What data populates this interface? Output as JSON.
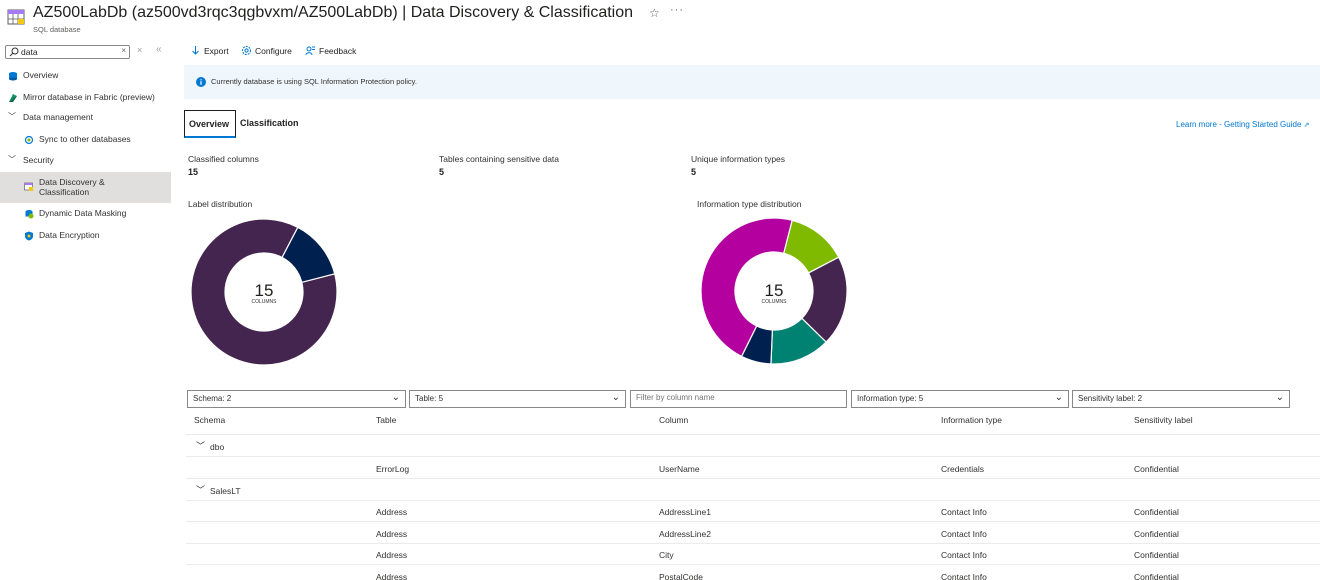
{
  "header": {
    "title": "AZ500LabDb (az500vd3rqc3qgbvxm/AZ500LabDb) | Data Discovery & Classification",
    "subtitle": "SQL database",
    "star": "☆",
    "more": "···"
  },
  "sidebar": {
    "search_value": "data",
    "clear": "×",
    "close": "×",
    "collapse": "«",
    "items": [
      {
        "label": "Overview"
      },
      {
        "label": "Mirror database in Fabric (preview)"
      },
      {
        "label": "Data management"
      },
      {
        "label": "Sync to other databases"
      },
      {
        "label": "Security"
      },
      {
        "label": "Data Discovery & Classification"
      },
      {
        "label": "Dynamic Data Masking"
      },
      {
        "label": "Data Encryption"
      }
    ]
  },
  "toolbar": {
    "export": "Export",
    "configure": "Configure",
    "feedback": "Feedback"
  },
  "info": "Currently database is using SQL Information Protection policy.",
  "tabs": [
    "Overview",
    "Classification"
  ],
  "learn_more": "Learn more - Getting Started Guide",
  "stats": [
    {
      "label": "Classified columns",
      "value": "15"
    },
    {
      "label": "Tables containing sensitive data",
      "value": "5"
    },
    {
      "label": "Unique information types",
      "value": "5"
    }
  ],
  "charts": {
    "label_title": "Label distribution",
    "info_title": "Information type distribution",
    "center_value": "15",
    "center_unit": "COLUMNS"
  },
  "chart_data": [
    {
      "type": "pie",
      "title": "Label distribution",
      "center": "15 COLUMNS",
      "slices": [
        {
          "value": 13,
          "color": "#43254f"
        },
        {
          "value": 2,
          "color": "#002050"
        }
      ]
    },
    {
      "type": "pie",
      "title": "Information type distribution",
      "center": "15 COLUMNS",
      "slices": [
        {
          "value": 2,
          "color": "#7fba00"
        },
        {
          "value": 3,
          "color": "#43254f"
        },
        {
          "value": 2,
          "color": "#008272"
        },
        {
          "value": 1,
          "color": "#002050"
        },
        {
          "value": 7,
          "color": "#b4009e"
        }
      ]
    }
  ],
  "filters": {
    "schema": "Schema: 2",
    "table": "Table: 5",
    "column_placeholder": "Filter by column name",
    "info_type": "Information type: 5",
    "sensitivity": "Sensitivity label: 2"
  },
  "table": {
    "headers": [
      "Schema",
      "Table",
      "Column",
      "Information type",
      "Sensitivity label"
    ],
    "groups": [
      {
        "schema": "dbo",
        "rows": [
          {
            "table": "ErrorLog",
            "column": "UserName",
            "info_type": "Credentials",
            "label": "Confidential"
          }
        ]
      },
      {
        "schema": "SalesLT",
        "rows": [
          {
            "table": "Address",
            "column": "AddressLine1",
            "info_type": "Contact Info",
            "label": "Confidential"
          },
          {
            "table": "Address",
            "column": "AddressLine2",
            "info_type": "Contact Info",
            "label": "Confidential"
          },
          {
            "table": "Address",
            "column": "City",
            "info_type": "Contact Info",
            "label": "Confidential"
          },
          {
            "table": "Address",
            "column": "PostalCode",
            "info_type": "Contact Info",
            "label": "Confidential"
          }
        ]
      }
    ]
  }
}
